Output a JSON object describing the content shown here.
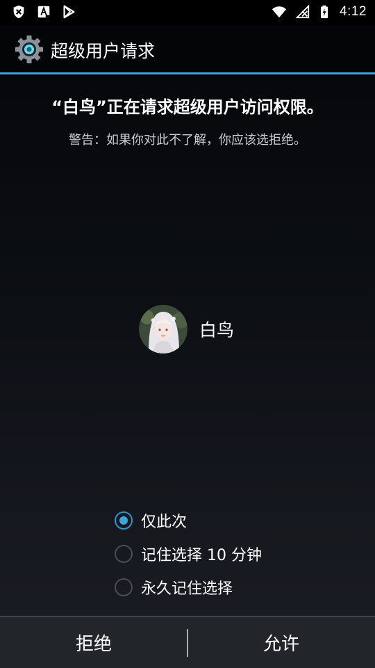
{
  "status_bar": {
    "time": "4:12",
    "left_icons": [
      "shield-x-icon",
      "font-a-icon",
      "play-triangle-icon"
    ],
    "right_icons": [
      "wifi-icon",
      "no-signal-icon",
      "battery-charging-icon"
    ]
  },
  "header": {
    "title": "超级用户请求",
    "icon": "gear-icon",
    "accent_color": "#3ea6df"
  },
  "request": {
    "title": "“白鸟”正在请求超级用户访问权限。",
    "warning": "警告：如果你对此不了解，你应该选拒绝。"
  },
  "app": {
    "name": "白鸟",
    "avatar_icon": "app-avatar-image"
  },
  "options": [
    {
      "label": "仅此次",
      "selected": true
    },
    {
      "label": "记住选择 10 分钟",
      "selected": false
    },
    {
      "label": "永久记住选择",
      "selected": false
    }
  ],
  "buttons": {
    "deny_label": "拒绝",
    "allow_label": "允许"
  }
}
